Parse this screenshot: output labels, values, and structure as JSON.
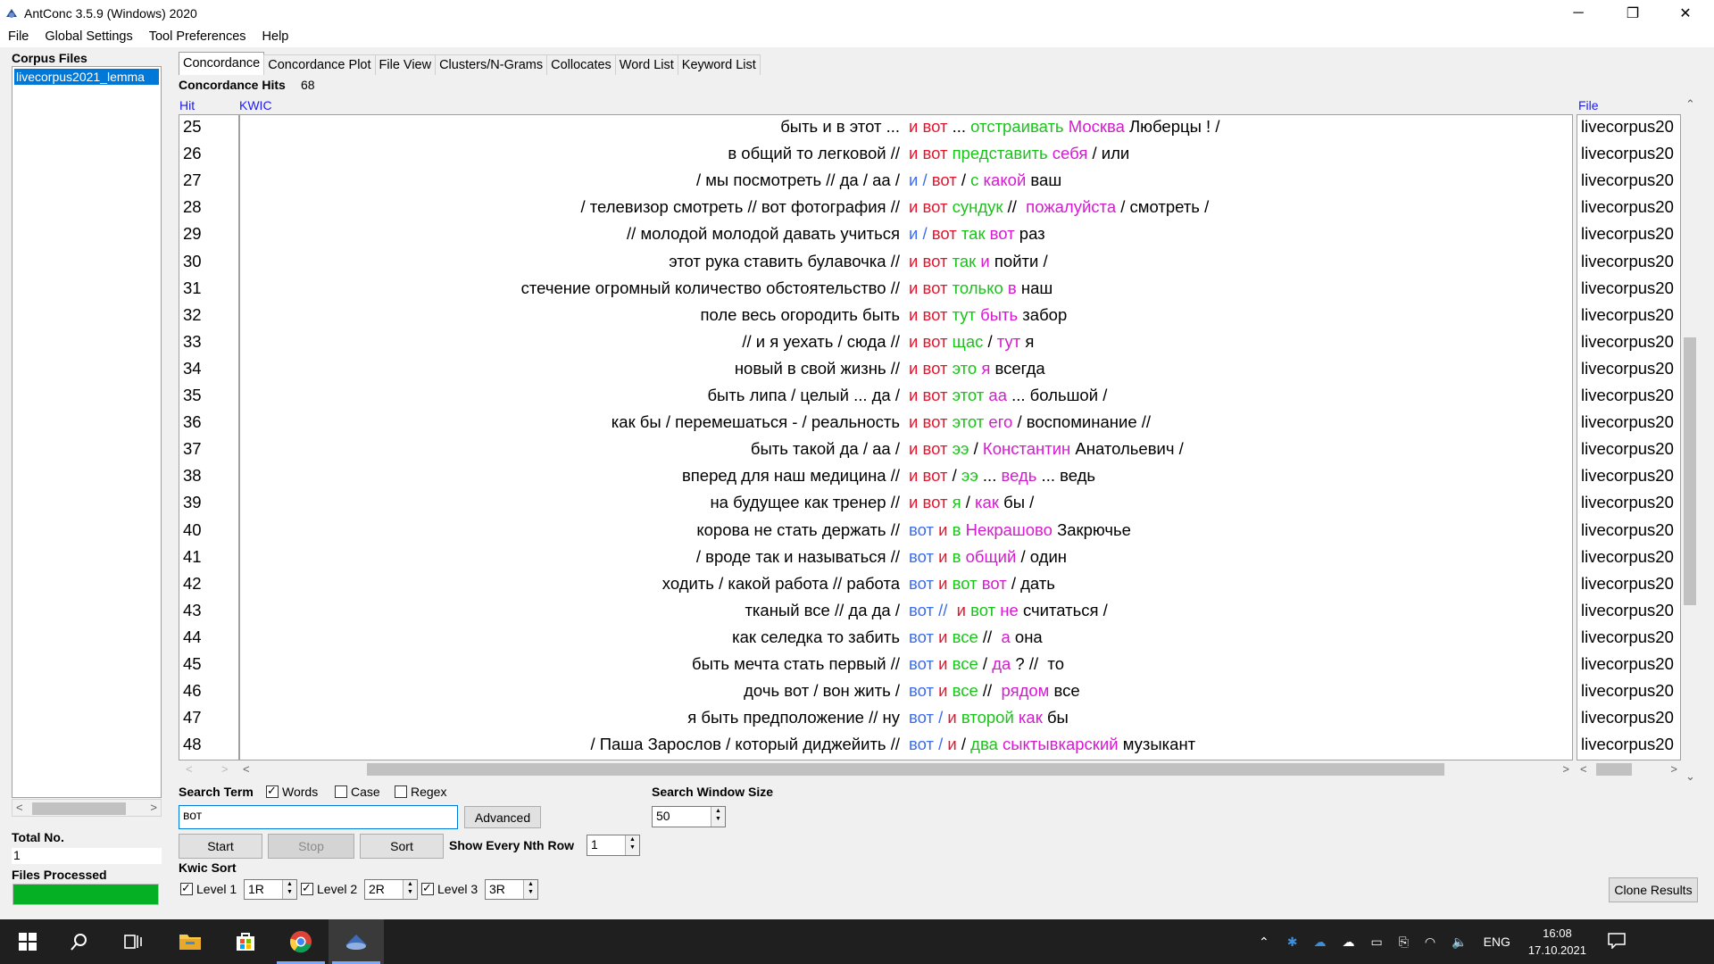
{
  "window": {
    "title": "AntConc 3.5.9 (Windows) 2020",
    "minimize": "─",
    "maximize": "❐",
    "close": "✕"
  },
  "menu": [
    "File",
    "Global Settings",
    "Tool Preferences",
    "Help"
  ],
  "left": {
    "corpus_files_label": "Corpus Files",
    "corpus_item": "livecorpus2021_lemma",
    "total_no_label": "Total No.",
    "total_no_value": "1",
    "files_processed_label": "Files Processed",
    "files_processed_progress": 1.0
  },
  "tabs": [
    "Concordance",
    "Concordance Plot",
    "File View",
    "Clusters/N-Grams",
    "Collocates",
    "Word List",
    "Keyword List"
  ],
  "concordance": {
    "hits_label": "Concordance Hits",
    "hits_count": "68",
    "col_hit": "Hit",
    "col_kwic": "KWIC",
    "col_file": "File",
    "file_value": "livecorpus20",
    "rows": [
      {
        "hit": "25",
        "left": "быть и в этот ...",
        "right": [
          [
            "и",
            "red"
          ],
          [
            " вот",
            "red"
          ],
          [
            " ...",
            "black"
          ],
          [
            " отстраивать",
            "green"
          ],
          [
            " Москва",
            "mag"
          ],
          [
            " Люберцы ! /",
            "black"
          ]
        ]
      },
      {
        "hit": "26",
        "left": "в общий то легковой //",
        "right": [
          [
            "и",
            "red"
          ],
          [
            " вот",
            "red"
          ],
          [
            " представить",
            "green"
          ],
          [
            " себя",
            "mag"
          ],
          [
            " / или",
            "black"
          ]
        ]
      },
      {
        "hit": "27",
        "left": "/ мы посмотреть //  да / аа /",
        "right": [
          [
            "и",
            "blue"
          ],
          [
            " /",
            "blue"
          ],
          [
            " вот",
            "red"
          ],
          [
            " /",
            "black"
          ],
          [
            " с",
            "green"
          ],
          [
            " какой",
            "mag"
          ],
          [
            " ваш",
            "black"
          ]
        ]
      },
      {
        "hit": "28",
        "left": "/ телевизор смотреть //  вот фотография //",
        "right": [
          [
            "и",
            "red"
          ],
          [
            " вот",
            "red"
          ],
          [
            " сундук",
            "green"
          ],
          [
            " //",
            "black"
          ],
          [
            "  пожалуйста",
            "mag"
          ],
          [
            " / смотреть /",
            "black"
          ]
        ]
      },
      {
        "hit": "29",
        "left": "//  молодой молодой давать учиться",
        "right": [
          [
            "и",
            "blue"
          ],
          [
            " /",
            "blue"
          ],
          [
            " вот",
            "red"
          ],
          [
            " так",
            "green"
          ],
          [
            " вот",
            "mag"
          ],
          [
            " раз",
            "black"
          ]
        ]
      },
      {
        "hit": "30",
        "left": "этот рука ставить булавочка //",
        "right": [
          [
            "и",
            "red"
          ],
          [
            " вот",
            "red"
          ],
          [
            " так",
            "green"
          ],
          [
            " и",
            "mag"
          ],
          [
            " пойти /",
            "black"
          ]
        ]
      },
      {
        "hit": "31",
        "left": "стечение огромный количество обстоятельство //",
        "right": [
          [
            "и",
            "red"
          ],
          [
            " вот",
            "red"
          ],
          [
            " только",
            "green"
          ],
          [
            " в",
            "mag"
          ],
          [
            " наш",
            "black"
          ]
        ]
      },
      {
        "hit": "32",
        "left": "поле весь огородить быть",
        "right": [
          [
            "и",
            "red"
          ],
          [
            " вот",
            "red"
          ],
          [
            " тут",
            "green"
          ],
          [
            " быть",
            "mag"
          ],
          [
            " забор",
            "black"
          ]
        ]
      },
      {
        "hit": "33",
        "left": "//  и я уехать / сюда //",
        "right": [
          [
            "и",
            "red"
          ],
          [
            " вот",
            "red"
          ],
          [
            " щас",
            "green"
          ],
          [
            " /",
            "black"
          ],
          [
            " тут",
            "mag"
          ],
          [
            " я",
            "black"
          ]
        ]
      },
      {
        "hit": "34",
        "left": "новый в свой жизнь //",
        "right": [
          [
            "и",
            "red"
          ],
          [
            " вот",
            "red"
          ],
          [
            " это",
            "green"
          ],
          [
            " я",
            "mag"
          ],
          [
            " всегда",
            "black"
          ]
        ]
      },
      {
        "hit": "35",
        "left": "быть липа / целый ... да /",
        "right": [
          [
            "и",
            "red"
          ],
          [
            " вот",
            "red"
          ],
          [
            " этот",
            "green"
          ],
          [
            " аа",
            "mag"
          ],
          [
            " ... большой /",
            "black"
          ]
        ]
      },
      {
        "hit": "36",
        "left": "как бы / перемешаться - / реальность",
        "right": [
          [
            "и",
            "red"
          ],
          [
            " вот",
            "red"
          ],
          [
            " этот",
            "green"
          ],
          [
            " его",
            "mag"
          ],
          [
            " / воспоминание //",
            "black"
          ]
        ]
      },
      {
        "hit": "37",
        "left": "быть такой да / аа /",
        "right": [
          [
            "и",
            "red"
          ],
          [
            " вот",
            "red"
          ],
          [
            " ээ",
            "green"
          ],
          [
            " /",
            "black"
          ],
          [
            " Константин",
            "mag"
          ],
          [
            " Анатольевич /",
            "black"
          ]
        ]
      },
      {
        "hit": "38",
        "left": "вперед для наш медицина //",
        "right": [
          [
            "и",
            "red"
          ],
          [
            " вот",
            "red"
          ],
          [
            " /",
            "black"
          ],
          [
            " ээ",
            "green"
          ],
          [
            " ...",
            "black"
          ],
          [
            " ведь",
            "mag"
          ],
          [
            " ... ведь",
            "black"
          ]
        ]
      },
      {
        "hit": "39",
        "left": "на будущее как тренер //",
        "right": [
          [
            "и",
            "red"
          ],
          [
            " вот",
            "red"
          ],
          [
            " я",
            "green"
          ],
          [
            " /",
            "black"
          ],
          [
            " как",
            "mag"
          ],
          [
            " бы /",
            "black"
          ]
        ]
      },
      {
        "hit": "40",
        "left": "корова не стать держать //",
        "right": [
          [
            "вот",
            "blue"
          ],
          [
            " и",
            "red"
          ],
          [
            " в",
            "green"
          ],
          [
            " Некрашово",
            "mag"
          ],
          [
            " Закрючье",
            "black"
          ]
        ]
      },
      {
        "hit": "41",
        "left": "/ вроде так и называться //",
        "right": [
          [
            "вот",
            "blue"
          ],
          [
            " и",
            "red"
          ],
          [
            " в",
            "green"
          ],
          [
            " общий",
            "mag"
          ],
          [
            " / один",
            "black"
          ]
        ]
      },
      {
        "hit": "42",
        "left": "ходить / какой работа //  работа",
        "right": [
          [
            "вот",
            "blue"
          ],
          [
            " и",
            "red"
          ],
          [
            " вот",
            "green"
          ],
          [
            " вот",
            "mag"
          ],
          [
            " / дать",
            "black"
          ]
        ]
      },
      {
        "hit": "43",
        "left": "тканый все //  да да /",
        "right": [
          [
            "вот",
            "blue"
          ],
          [
            " //",
            "blue"
          ],
          [
            "  и",
            "red"
          ],
          [
            " вот",
            "green"
          ],
          [
            " не",
            "mag"
          ],
          [
            " считаться /",
            "black"
          ]
        ]
      },
      {
        "hit": "44",
        "left": "как селедка то забить",
        "right": [
          [
            "вот",
            "blue"
          ],
          [
            " и",
            "red"
          ],
          [
            " все",
            "green"
          ],
          [
            " //",
            "black"
          ],
          [
            "  а",
            "mag"
          ],
          [
            " она",
            "black"
          ]
        ]
      },
      {
        "hit": "45",
        "left": "быть мечта стать первый //",
        "right": [
          [
            "вот",
            "blue"
          ],
          [
            " и",
            "red"
          ],
          [
            " все",
            "green"
          ],
          [
            " /",
            "black"
          ],
          [
            " да",
            "mag"
          ],
          [
            " ? //  то",
            "black"
          ]
        ]
      },
      {
        "hit": "46",
        "left": "дочь вот / вон жить /",
        "right": [
          [
            "вот",
            "blue"
          ],
          [
            " и",
            "red"
          ],
          [
            " все",
            "green"
          ],
          [
            " //",
            "black"
          ],
          [
            "  рядом",
            "mag"
          ],
          [
            " все",
            "black"
          ]
        ]
      },
      {
        "hit": "47",
        "left": "я быть предположение //  ну",
        "right": [
          [
            "вот",
            "blue"
          ],
          [
            " /",
            "blue"
          ],
          [
            " и",
            "red"
          ],
          [
            " второй",
            "green"
          ],
          [
            " как",
            "mag"
          ],
          [
            " бы",
            "black"
          ]
        ]
      },
      {
        "hit": "48",
        "left": "/ Паша Зарослов / который диджейить //",
        "right": [
          [
            "вот",
            "blue"
          ],
          [
            " /",
            "blue"
          ],
          [
            " и",
            "red"
          ],
          [
            " /",
            "black"
          ],
          [
            " два",
            "green"
          ],
          [
            " сыктывкарский",
            "mag"
          ],
          [
            " музыкант",
            "black"
          ]
        ]
      }
    ]
  },
  "search": {
    "term_label": "Search Term",
    "opt_words": "Words",
    "opt_words_checked": true,
    "opt_case": "Case",
    "opt_case_checked": false,
    "opt_regex": "Regex",
    "opt_regex_checked": false,
    "term_value": "вот",
    "advanced": "Advanced",
    "window_size_label": "Search Window Size",
    "window_size_value": "50",
    "start": "Start",
    "stop": "Stop",
    "sort": "Sort",
    "nth_row_label": "Show Every Nth Row",
    "nth_row_value": "1"
  },
  "kwic_sort": {
    "label": "Kwic Sort",
    "level1_label": "Level 1",
    "level1_value": "1R",
    "level2_label": "Level 2",
    "level2_value": "2R",
    "level3_label": "Level 3",
    "level3_value": "3R"
  },
  "clone_results": "Clone Results",
  "tray": {
    "lang": "ENG",
    "time": "16:08",
    "date": "17.10.2021"
  },
  "colors": {
    "red": "#e8132c",
    "blue": "#3c6cf0",
    "green": "#18c418",
    "mag": "#d61ad0",
    "selection": "#0078d7",
    "progress": "#06b025"
  }
}
